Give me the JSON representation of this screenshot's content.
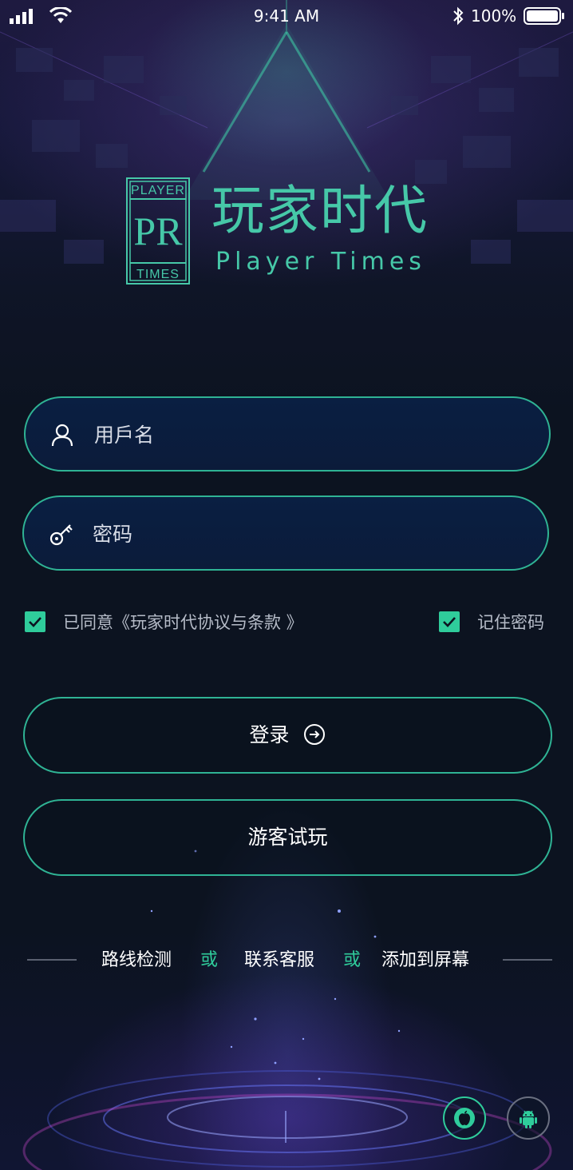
{
  "status_bar": {
    "time": "9:41 AM",
    "battery": "100%"
  },
  "brand": {
    "title": "玩家时代",
    "subtitle": "Player Times",
    "logo_top": "PLAYER",
    "logo_mark": "PR",
    "logo_bottom": "TIMES"
  },
  "form": {
    "username_placeholder": "用戶名",
    "password_placeholder": "密码",
    "username_icon": "user-icon",
    "password_icon": "key-icon"
  },
  "options": {
    "agree_label": "已同意《玩家时代协议与条款 》",
    "agree_checked": true,
    "remember_label": "记住密码",
    "remember_checked": true
  },
  "buttons": {
    "login_label": "登录",
    "guest_label": "游客试玩"
  },
  "links": {
    "route_check": "路线检测",
    "separator": "或",
    "contact_service": "联系客服",
    "add_to_screen": "添加到屏幕"
  },
  "platforms": [
    {
      "name": "apple-icon",
      "active": true
    },
    {
      "name": "android-icon",
      "active": false
    }
  ],
  "colors": {
    "accent": "#2fcc9b",
    "brand_text": "#46c8a8",
    "field_bg": "#0a1f42",
    "page_bg": "#0c1320"
  }
}
